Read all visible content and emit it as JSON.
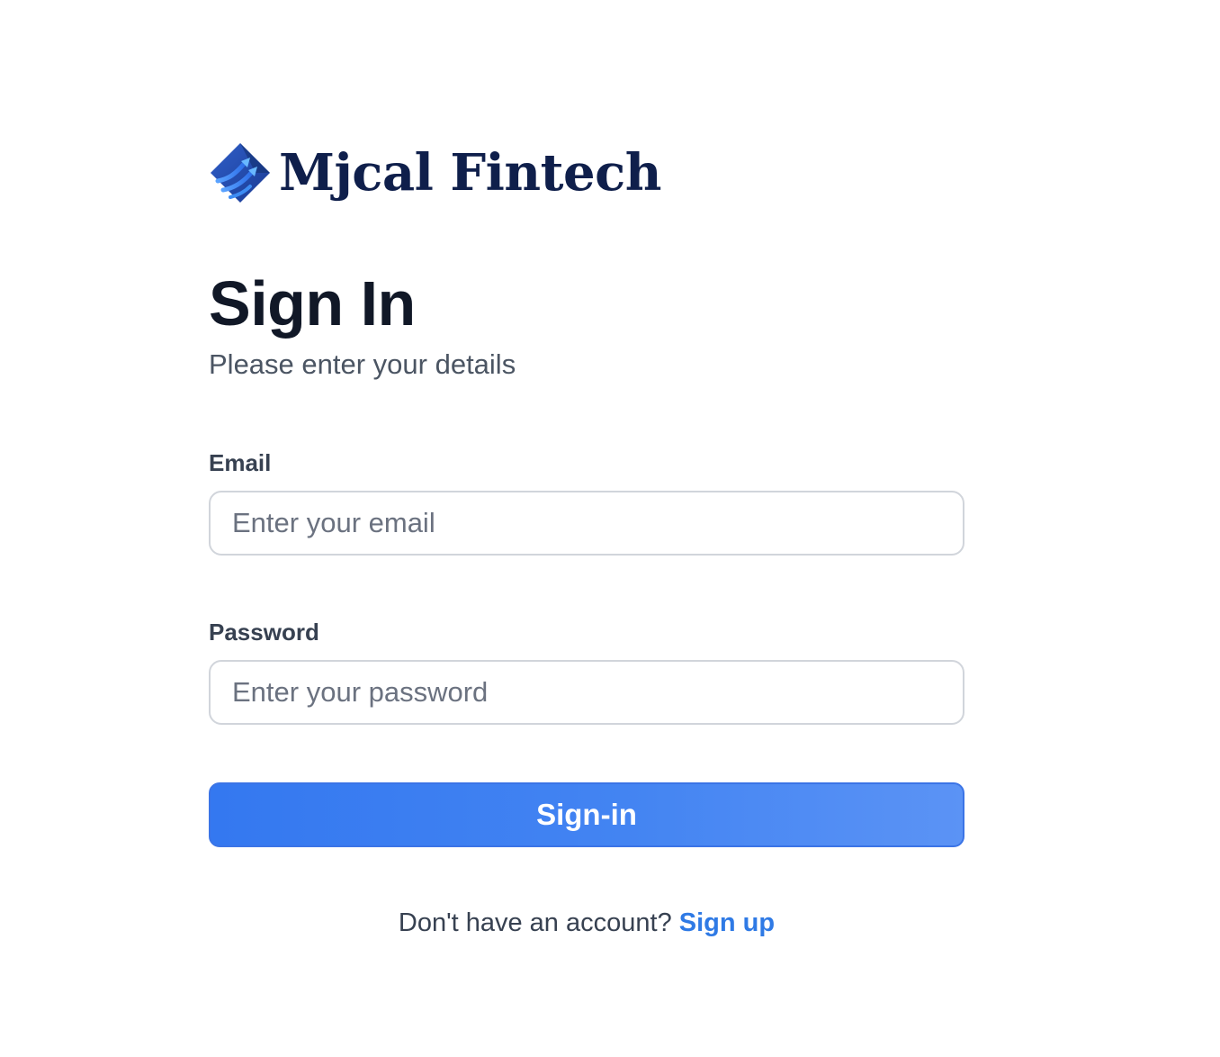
{
  "brand": {
    "name": "Mjcal Fintech",
    "logo_icon": "rising-arrows-diamond-icon",
    "color": "#0f1f4b"
  },
  "header": {
    "title": "Sign In",
    "subtitle": "Please enter your details"
  },
  "form": {
    "email": {
      "label": "Email",
      "placeholder": "Enter your email",
      "value": ""
    },
    "password": {
      "label": "Password",
      "placeholder": "Enter your password",
      "value": ""
    },
    "submit_label": "Sign-in"
  },
  "footer": {
    "prompt": "Don't have an account?",
    "link_label": "Sign up"
  },
  "colors": {
    "primary": "#3b82f6",
    "link": "#2f7ae5",
    "heading": "#111827",
    "muted": "#4b5563"
  }
}
